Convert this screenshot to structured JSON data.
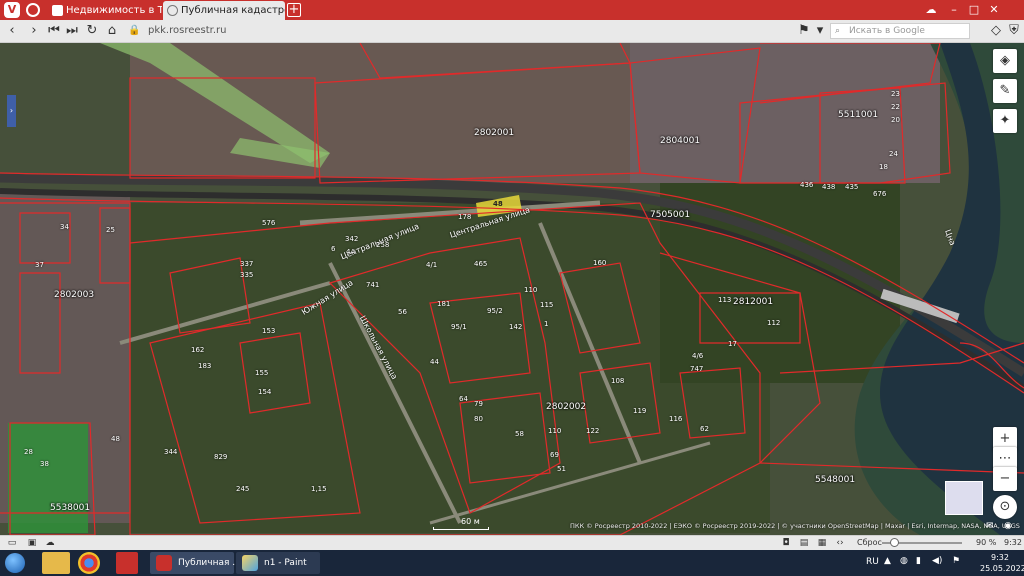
{
  "browser": {
    "tabs": [
      {
        "label": "Недвижимость в Тамбове",
        "active": false
      },
      {
        "label": "Публичная кадастровая к",
        "active": true
      }
    ],
    "url": "pkk.rosreestr.ru",
    "search_placeholder": "Искать в Google",
    "accent_color": "#c8302c"
  },
  "map": {
    "quarters": [
      "2802001",
      "2804001",
      "5511001",
      "7505001",
      "2802003",
      "2812001",
      "2802002",
      "5538001",
      "5548001"
    ],
    "streets": [
      "Центральная улица",
      "Центральная улица",
      "Южная улица",
      "Школьная улица"
    ],
    "highlighted_parcel": "48",
    "parcel_numbers": [
      "576",
      "342",
      "4А",
      "6",
      "258",
      "178",
      "337",
      "335",
      "741",
      "4/1",
      "465",
      "160",
      "110",
      "115",
      "56",
      "181",
      "95/1",
      "95/2",
      "142",
      "1",
      "153",
      "162",
      "183",
      "155",
      "154",
      "113",
      "112",
      "17",
      "4/6",
      "747",
      "108",
      "116",
      "119",
      "62",
      "64",
      "79",
      "80",
      "44",
      "58",
      "110",
      "69",
      "122",
      "51",
      "1,15",
      "829",
      "344",
      "245",
      "38",
      "48",
      "28",
      "436",
      "438",
      "435",
      "676",
      "23",
      "22",
      "20",
      "24",
      "18",
      "34",
      "25",
      "37"
    ],
    "river_label": "Цна",
    "scale_label": "60 м",
    "attribution": "ПКК © Росреестр 2010-2022 | ЕЭКО © Росреестр 2019-2022 | © участники OpenStreetMap | Maxar | Esri, Intermap, NASA, NGA, USGS"
  },
  "statusbar": {
    "zoom_reset_label": "Сброс",
    "zoom_percent": "90 %",
    "zoom_value": 90,
    "time": "9:32"
  },
  "taskbar": {
    "tasks": [
      {
        "label": "Публичная ..."
      },
      {
        "label": "n1 - Paint"
      }
    ],
    "language": "RU",
    "clock_time": "9:32",
    "clock_date": "25.05.2022"
  }
}
